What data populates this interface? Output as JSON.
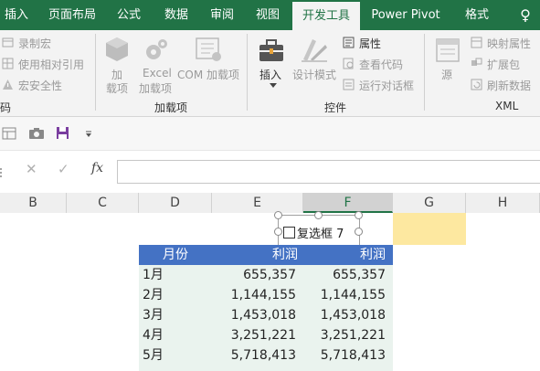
{
  "tabs": [
    {
      "label": "插入",
      "active": false
    },
    {
      "label": "页面布局",
      "active": false
    },
    {
      "label": "公式",
      "active": false
    },
    {
      "label": "数据",
      "active": false
    },
    {
      "label": "审阅",
      "active": false
    },
    {
      "label": "视图",
      "active": false
    },
    {
      "label": "开发工具",
      "active": true
    },
    {
      "label": "Power Pivot",
      "active": false
    },
    {
      "label": "格式",
      "active": false
    },
    {
      "label": "♀",
      "active": false
    }
  ],
  "ribbon": {
    "code": {
      "record_macro": "录制宏",
      "relative_ref": "使用相对引用",
      "macro_security": "宏安全性",
      "group_label": "码"
    },
    "addins": {
      "addins_line1": "加",
      "addins_line2": "载项",
      "excel_line1": "Excel",
      "excel_line2": "加载项",
      "com": "COM 加载项",
      "group_label": "加载项"
    },
    "controls": {
      "insert": "插入",
      "design_mode": "设计模式",
      "properties": "属性",
      "view_code": "查看代码",
      "run_dialog": "运行对话框",
      "group_label": "控件"
    },
    "xml": {
      "source": "源",
      "map_props": "映射属性",
      "expansion": "扩展包",
      "refresh": "刷新数据",
      "group_label": "XML"
    }
  },
  "formula_bar": {
    "cancel": "✕",
    "confirm": "✓",
    "fx": "fx",
    "value": ""
  },
  "columns": [
    "B",
    "C",
    "D",
    "E",
    "F",
    "G",
    "H"
  ],
  "checkbox": {
    "label": "复选框 7"
  },
  "table": {
    "headers": [
      "月份",
      "利润",
      "利润"
    ],
    "rows": [
      [
        "1月",
        "655,357",
        "655,357"
      ],
      [
        "2月",
        "1,144,155",
        "1,144,155"
      ],
      [
        "3月",
        "1,453,018",
        "1,453,018"
      ],
      [
        "4月",
        "3,251,221",
        "3,251,221"
      ],
      [
        "5月",
        "5,718,413",
        "5,718,413"
      ]
    ]
  },
  "colors": {
    "ribbon_green": "#217346",
    "header_blue": "#4472c4",
    "row_fill": "#eaf3ee",
    "highlight_cell": "#fde8a0"
  }
}
